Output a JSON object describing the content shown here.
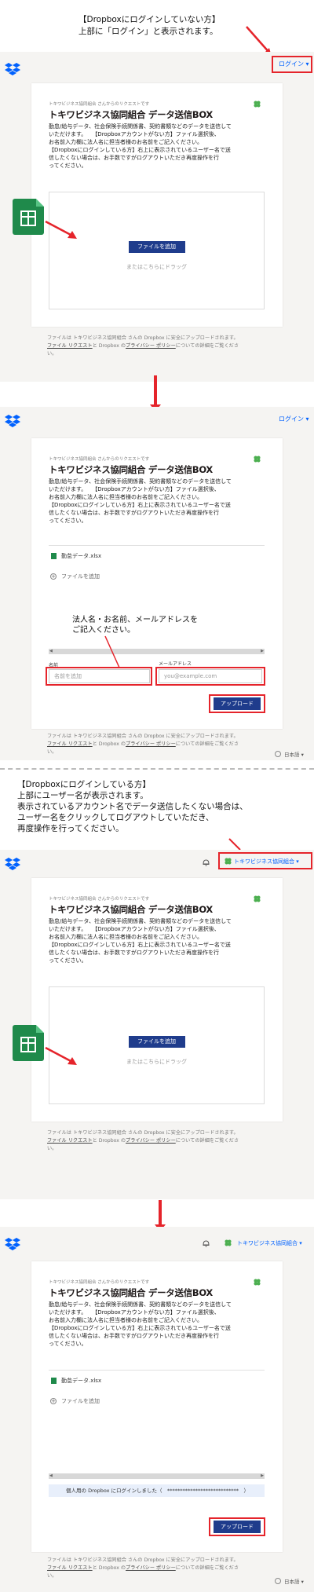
{
  "colors": {
    "accent": "#e5242b",
    "dropbox_blue": "#0061fe",
    "button_navy": "#1f3c8c",
    "panel_bg": "#f5f4f2",
    "sheets_green": "#1f8a4b"
  },
  "notes": {
    "top_line1": "【Dropboxにログインしていない方】",
    "top_line2": "上部に「ログイン」と表示されます。",
    "hint_fields_line1": "法人名・お名前、メールアドレスを",
    "hint_fields_line2": "ご記入ください。",
    "mid_line1": "【Dropboxにログインしている方】",
    "mid_line2": "上部にユーザー名が表示されます。",
    "mid_line3": "表示されているアカウント名でデータ送信したくない場合は、",
    "mid_line4": "ユーザー名をクリックしてログアウトしていただき、",
    "mid_line5": "再度操作を行ってください。"
  },
  "header": {
    "login_label": "ログイン",
    "user_name": "トキワビジネス協同組合"
  },
  "card": {
    "request_from": "トキワビジネス協同組合 さんからのリクエストです",
    "title": "トキワビジネス協同組合 データ送信BOX",
    "desc_lines": [
      "勤怠/給与データ、社会保険手続関係書、契約書類などのデータを送信して",
      "いただけます。　　【Dropboxアカウントがない方】ファイル選択後、",
      "お名前入力欄に法人名に担当者様のお名前をご記入ください。",
      "【Dropboxにログインしている方】右上に表示されているユーザー名で送",
      "信したくない場合は、お手数ですがログアウトいただき再度操作を行",
      "ってください。"
    ],
    "add_files_button": "ファイルを追加",
    "drag_hint": "またはこちらにドラッグ",
    "file_name": "勤怠データ.xlsx",
    "add_files_link": "ファイルを追加",
    "name_label": "名前",
    "name_placeholder": "名前を追加",
    "email_label": "メールアドレス",
    "email_placeholder": "you@example.com",
    "upload_button": "アップロード",
    "logged_in_banner": "個人用の Dropbox にログインしました（　****************************　）"
  },
  "footer": {
    "line1": "ファイルは トキワビジネス協同組合 さんの Dropbox に安全にアップロードされます。",
    "link1": "ファイル リクエスト",
    "mid": "と Dropbox の",
    "link2": "プライバシー ポリシー",
    "tail": "についての詳細をご覧くださ",
    "line3": "い。",
    "language": "日本語"
  }
}
